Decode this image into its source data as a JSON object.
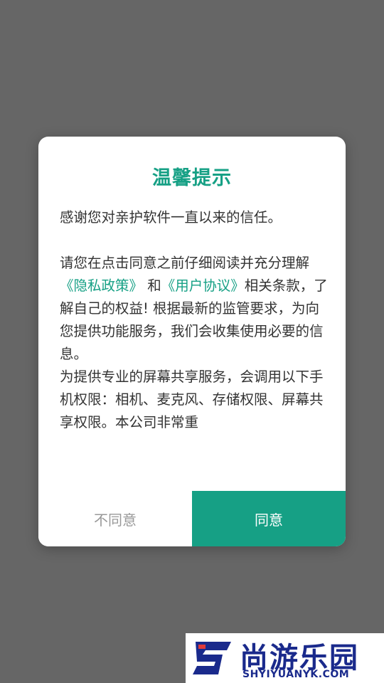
{
  "dialog": {
    "title": "温馨提示",
    "intro": "感谢您对亲护软件一直以来的信任。",
    "para_prefix": "请您在点击同意之前仔细阅读并充分理解",
    "privacy_link": "《隐私政策》",
    "and_text": " 和",
    "agreement_link": "《用户协议》",
    "para_rest": "相关条款，了解自己的权益! 根据最新的监管要求，为向您提供功能服务，我们会收集使用必要的信息。",
    "para2": "为提供专业的屏幕共享服务，会调用以下手机权限：相机、麦克风、存储权限、屏幕共享权限。本公司非常重",
    "disagree_label": "不同意",
    "agree_label": "同意"
  },
  "watermark": {
    "name_cn": "尚游乐园",
    "name_en": "SHYIYUANYK.COM"
  },
  "colors": {
    "accent": "#16a085",
    "overlay": "#666666",
    "watermark_blue": "#1a2a8c"
  }
}
